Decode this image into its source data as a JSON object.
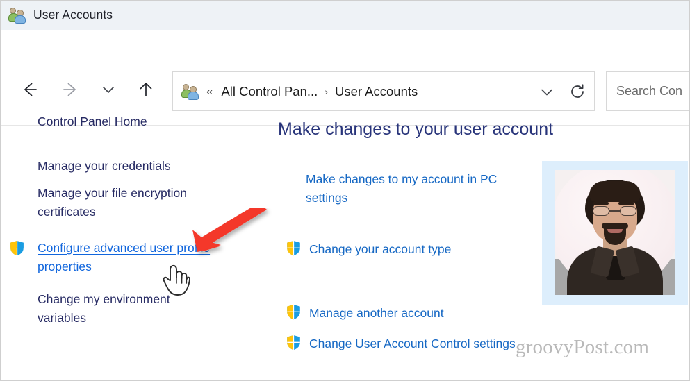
{
  "window": {
    "title": "User Accounts",
    "title_icon": "users-icon"
  },
  "toolbar": {
    "back_icon": "arrow-left-icon",
    "forward_icon": "arrow-right-icon",
    "recent_icon": "chevron-down-icon",
    "up_icon": "arrow-up-icon",
    "address_icon": "users-icon",
    "overflow_marker": "«",
    "breadcrumb": [
      "All Control Pan...",
      "User Accounts"
    ],
    "breadcrumb_separator": "›",
    "address_dropdown_icon": "chevron-down-icon",
    "refresh_icon": "refresh-icon",
    "search": {
      "placeholder": "Search Con",
      "value": ""
    }
  },
  "sidebar": {
    "items": [
      {
        "label": "Control Panel Home",
        "shield": false,
        "state": "normal"
      },
      {
        "label": "Manage your credentials",
        "shield": false,
        "state": "normal"
      },
      {
        "label": "Manage your file encryption certificates",
        "shield": false,
        "state": "normal"
      },
      {
        "label": "Configure advanced user profile properties",
        "shield": true,
        "state": "hovered"
      },
      {
        "label": "Change my environment variables",
        "shield": false,
        "state": "normal"
      }
    ]
  },
  "main": {
    "heading": "Make changes to your user account",
    "links": [
      {
        "label": "Make changes to my account in PC settings",
        "shield": false
      },
      {
        "label": "Change your account type",
        "shield": true
      },
      {
        "label": "Manage another account",
        "shield": true
      },
      {
        "label": "Change User Account Control settings",
        "shield": true
      }
    ],
    "avatar": {
      "alt": "user-account-picture"
    }
  },
  "annotations": {
    "arrow": "red-arrow-pointing-to-configure-advanced-user-profile-properties",
    "cursor": "hand-pointer-cursor"
  },
  "watermark": {
    "text": "groovyPost.com"
  },
  "colors": {
    "titlebar_bg": "#eef2f6",
    "heading": "#28347a",
    "link": "#1668c4",
    "sidebar_link": "#262a63",
    "hover_link": "#1166dd",
    "arrow_red": "#f4372b",
    "avatar_frame": "#ddeefc",
    "shield_yellow": "#ffc40a",
    "shield_blue": "#1b9de2"
  }
}
